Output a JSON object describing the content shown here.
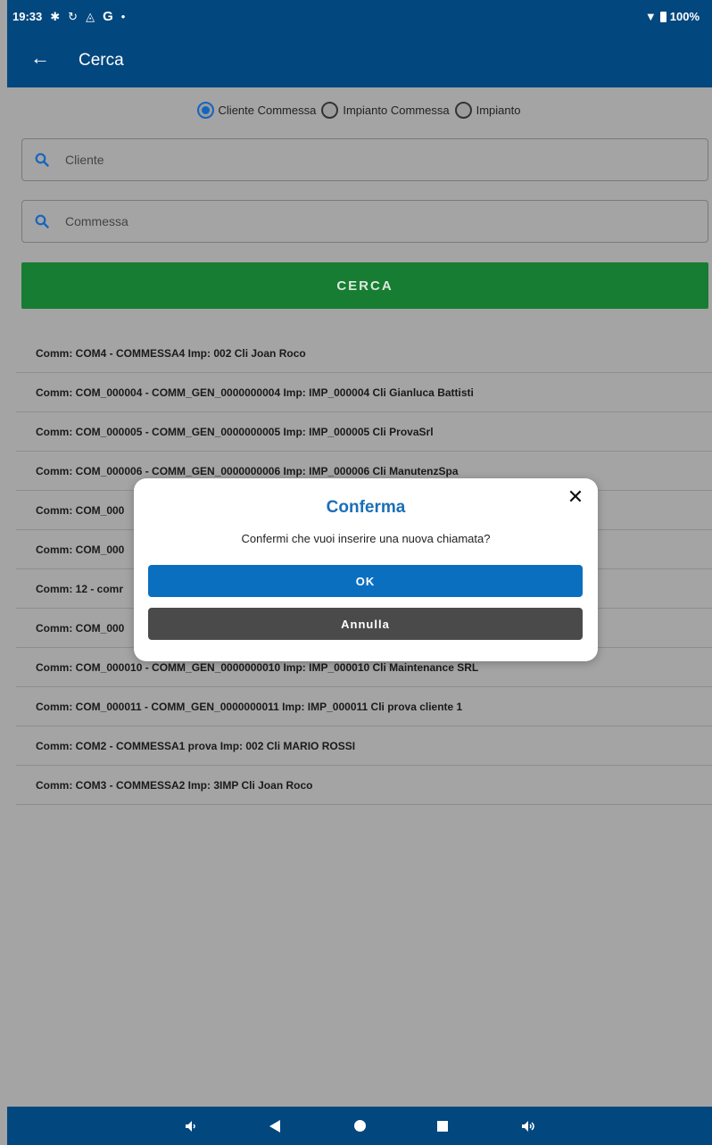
{
  "status_bar": {
    "time": "19:33",
    "battery": "100%"
  },
  "app_bar": {
    "title": "Cerca"
  },
  "search_mode": {
    "options": [
      {
        "label": "Cliente Commessa",
        "selected": true
      },
      {
        "label": "Impianto Commessa",
        "selected": false
      },
      {
        "label": "Impianto",
        "selected": false
      }
    ]
  },
  "fields": {
    "cliente_placeholder": "Cliente",
    "commessa_placeholder": "Commessa"
  },
  "cerca_label": "CERCA",
  "results": [
    "Comm: COM4 - COMMESSA4 Imp: 002 Cli Joan Roco",
    "Comm: COM_000004 - COMM_GEN_0000000004 Imp: IMP_000004 Cli Gianluca Battisti",
    "Comm: COM_000005 - COMM_GEN_0000000005 Imp: IMP_000005 Cli ProvaSrl",
    "Comm: COM_000006 - COMM_GEN_0000000006 Imp: IMP_000006 Cli ManutenzSpa",
    "Comm: COM_000",
    "Comm: COM_000",
    "Comm: 12 - comr",
    "Comm: COM_000",
    "Comm: COM_000010 - COMM_GEN_0000000010 Imp: IMP_000010 Cli Maintenance SRL",
    "Comm: COM_000011 - COMM_GEN_0000000011 Imp: IMP_000011 Cli prova cliente 1",
    "Comm: COM2 - COMMESSA1 prova Imp: 002 Cli MARIO ROSSI",
    "Comm: COM3 - COMMESSA2 Imp: 3IMP Cli Joan Roco"
  ],
  "dialog": {
    "title": "Conferma",
    "message": "Confermi che vuoi inserire una nuova chiamata?",
    "ok_label": "OK",
    "cancel_label": "Annulla"
  },
  "colors": {
    "app_bar": "#03477f",
    "primary_blue": "#0b6fbf",
    "cerca_green": "#177d32",
    "cancel_gray": "#4a4a4a"
  }
}
